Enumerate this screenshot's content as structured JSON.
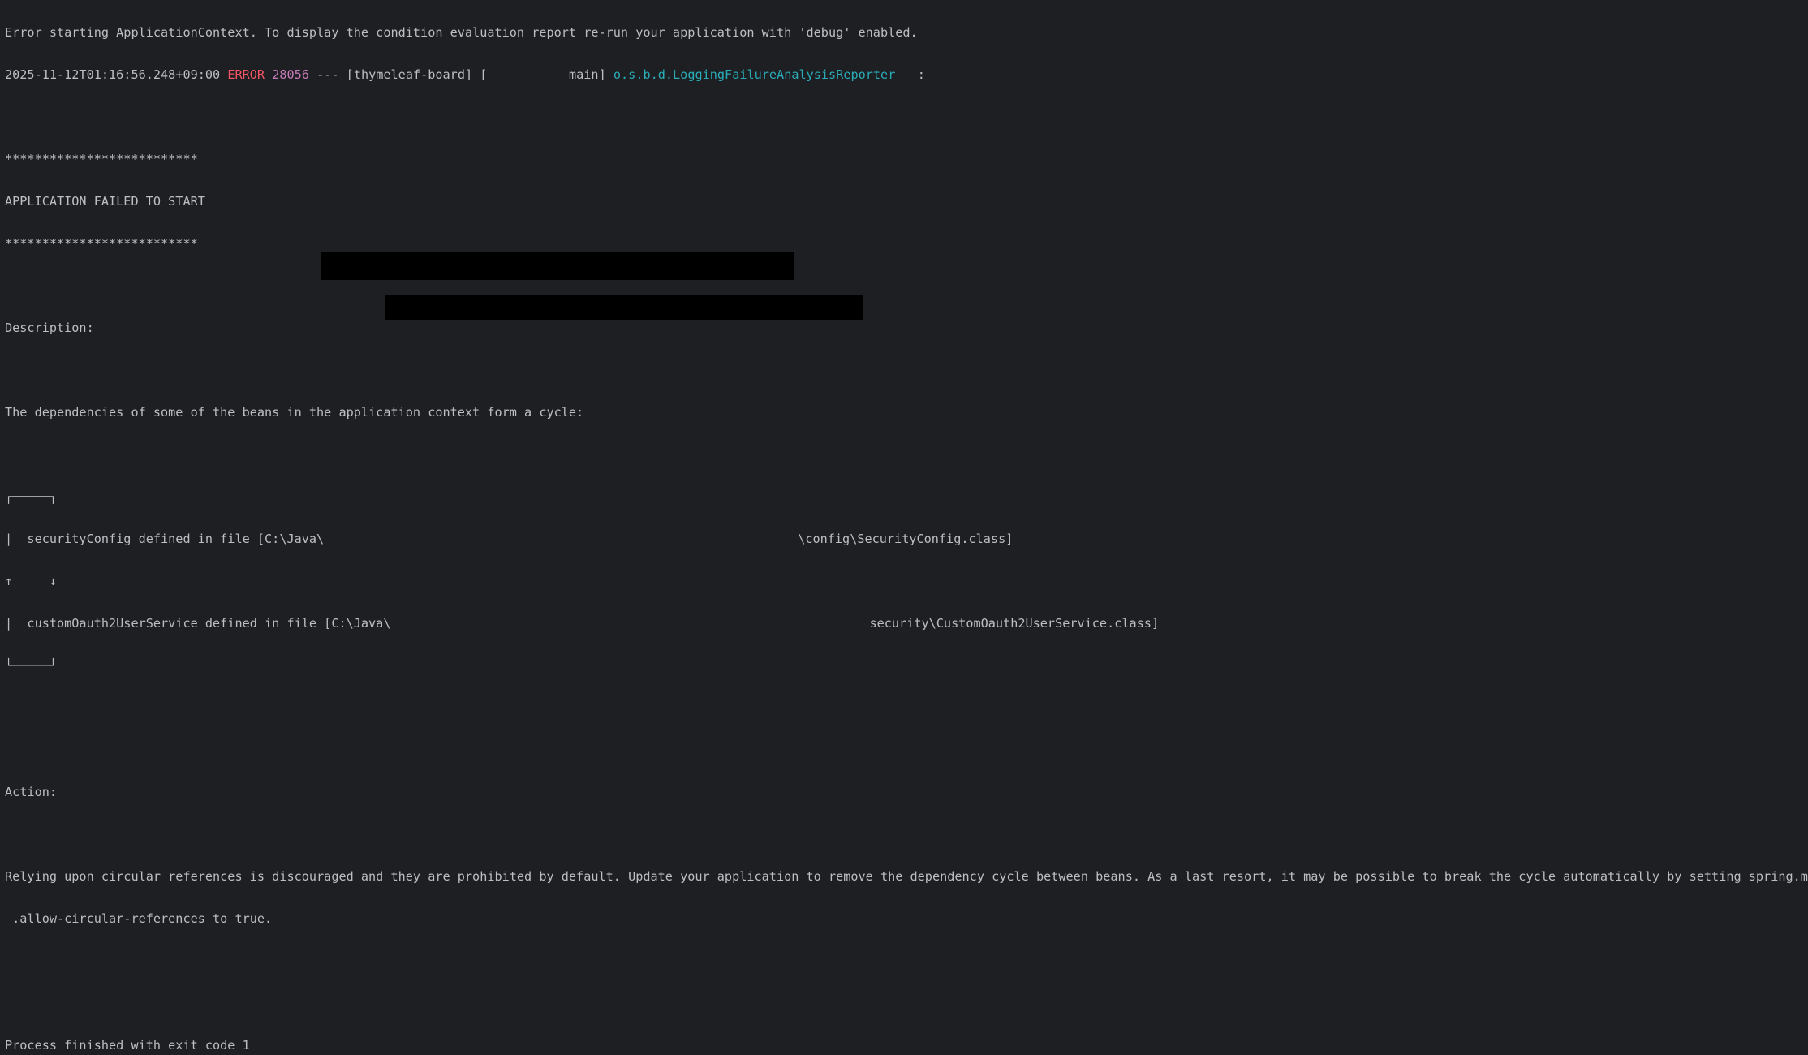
{
  "console": {
    "line_intro": "Error starting ApplicationContext. To display the condition evaluation report re-run your application with 'debug' enabled.",
    "log": {
      "timestamp": "2025-11-12T01:16:56.248+09:00",
      "level": "ERROR",
      "pid": "28056",
      "sep": "---",
      "app": "[thymeleaf-board]",
      "thread": "[           main]",
      "logger": "o.s.b.d.LoggingFailureAnalysisReporter",
      "colon": "  :"
    },
    "stars": "**************************",
    "failed": "APPLICATION FAILED TO START",
    "description_label": "Description:",
    "description": "The dependencies of some of the beans in the application context form a cycle:",
    "cycle": {
      "top": "┌─────┐",
      "bean1_prefix": "|  securityConfig defined in file [C:\\Java\\",
      "bean1_suffix": "\\config\\SecurityConfig.class]",
      "arrows": "↑     ↓",
      "bean2_prefix": "|  customOauth2UserService defined in file [C:\\Java\\",
      "bean2_suffix": "security\\CustomOauth2UserService.class]",
      "bottom": "└─────┘"
    },
    "action_label": "Action:",
    "action_line1": "Relying upon circular references is discouraged and they are prohibited by default. Update your application to remove the dependency cycle between beans. As a last resort, it may be possible to break the cycle automatically by setting spring.main",
    "action_line2": " .allow-circular-references to true.",
    "exit": "Process finished with exit code 1"
  }
}
